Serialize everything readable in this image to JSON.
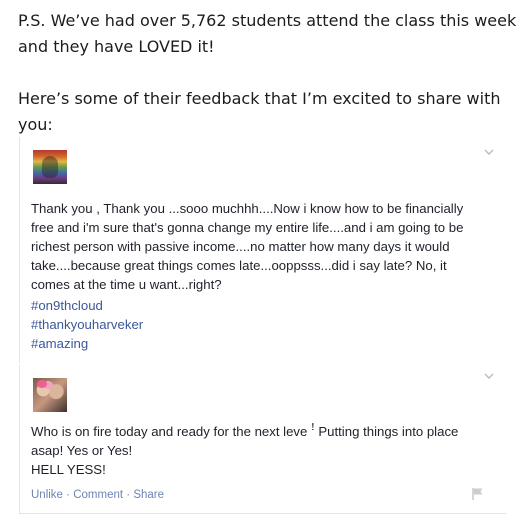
{
  "intro": {
    "ps": "P.S. We’ve had over 5,762 students attend the class this week and they have LOVED it!",
    "lead": "Here’s some of their feedback that I’m excited to share with you:"
  },
  "posts": [
    {
      "text": "Thank you , Thank you ...sooo muchhh....Now i know how to be financially\nfree and i'm sure that's gonna change my entire life....and i am going to be\nrichest person with passive income....no matter how many days it would\ntake....because great things comes late...ooppsss...did i say late? No, it\ncomes at the time u want...right?",
      "hashtags": [
        "#on9thcloud",
        "#thankyouharveker",
        "#amazing"
      ]
    },
    {
      "text": "Who is on fire today and ready for the next leve ꜝ Putting things into place\nasap! Yes or Yes!\nHELL YESS!",
      "actions": {
        "unlike": "Unlike",
        "comment": "Comment",
        "share": "Share",
        "separator": "·"
      }
    }
  ],
  "colors": {
    "link": "#3b5998",
    "actions": "#6d84b4",
    "border": "#e0e3e8",
    "text": "#1d2129"
  },
  "icons": {
    "chevron": "chevron-down-icon",
    "flag": "flag-icon"
  }
}
